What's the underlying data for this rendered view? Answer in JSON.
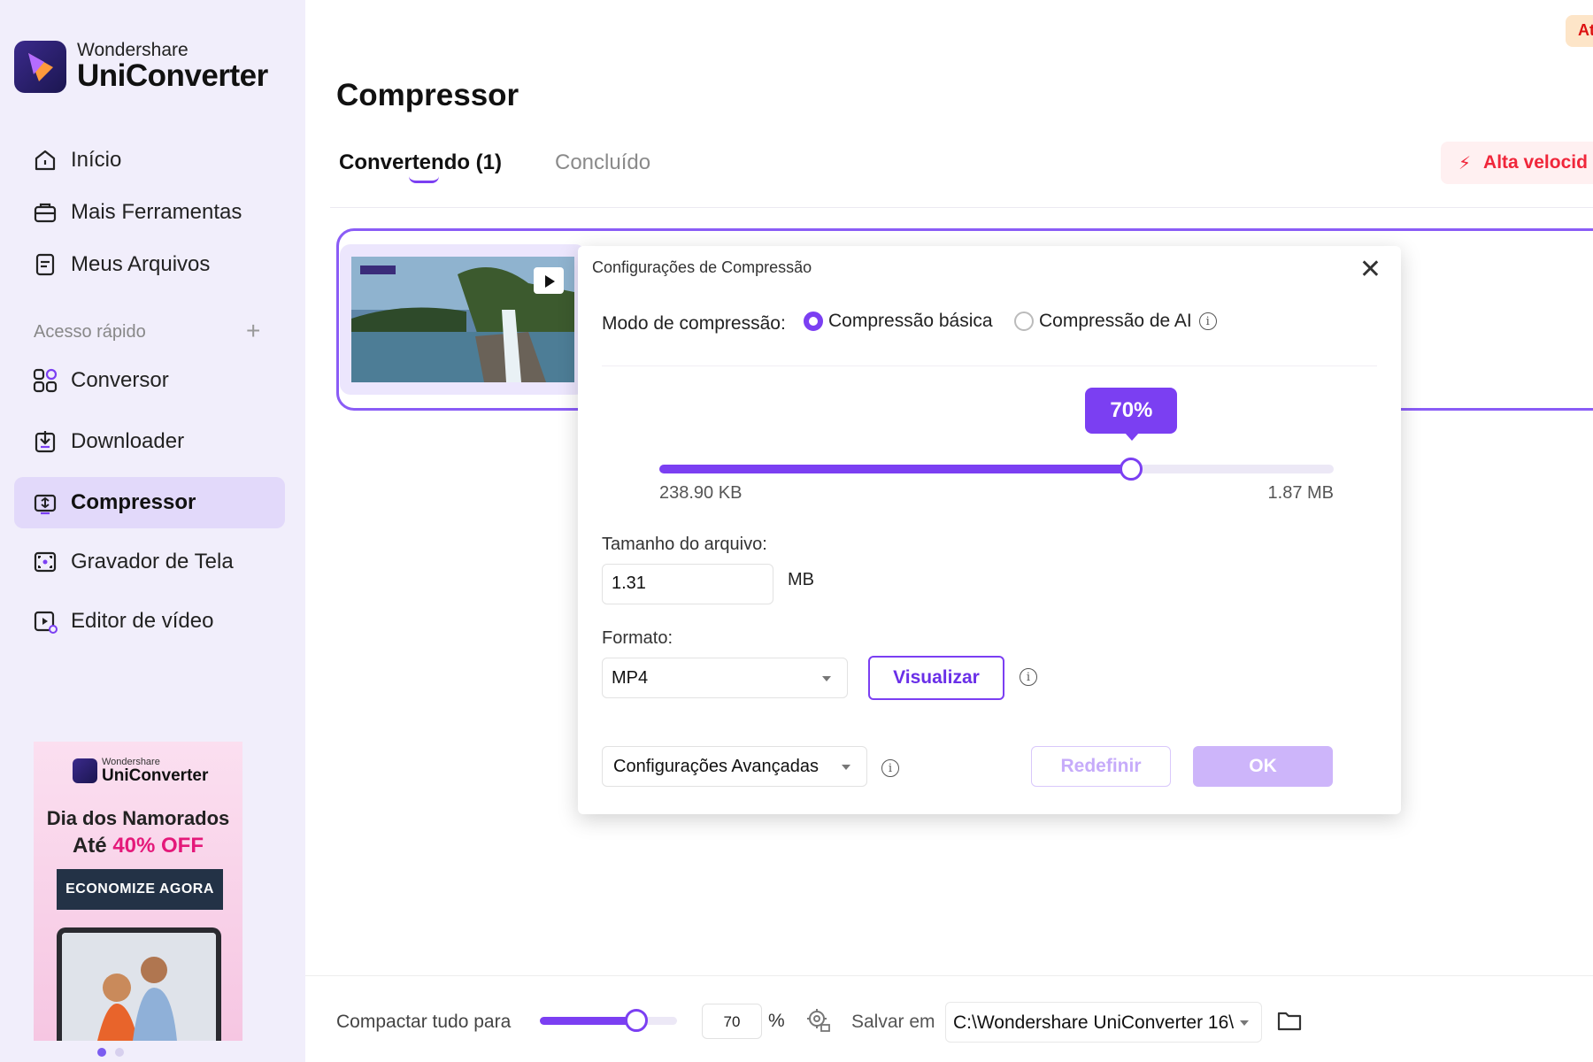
{
  "app": {
    "brand": "Wondershare",
    "product": "UniConverter"
  },
  "sidebar": {
    "items": [
      {
        "label": "Início",
        "icon": "home-icon"
      },
      {
        "label": "Mais Ferramentas",
        "icon": "toolbox-icon"
      },
      {
        "label": "Meus Arquivos",
        "icon": "file-icon"
      }
    ],
    "quick_access_label": "Acesso rápido",
    "quick_items": [
      {
        "label": "Conversor",
        "icon": "convert-icon"
      },
      {
        "label": "Downloader",
        "icon": "download-icon"
      },
      {
        "label": "Compressor",
        "icon": "compress-icon",
        "active": true
      },
      {
        "label": "Gravador de Tela",
        "icon": "screen-record-icon"
      },
      {
        "label": "Editor de vídeo",
        "icon": "video-edit-icon"
      }
    ]
  },
  "ad": {
    "brand": "Wondershare",
    "product": "UniConverter",
    "title": "Dia dos Namorados",
    "subtitle_prefix": "Até ",
    "subtitle_highlight": "40% OFF",
    "cta": "ECONOMIZE AGORA"
  },
  "header": {
    "badge": "At",
    "title": "Compressor",
    "tabs": [
      {
        "label": "Convertendo (1)",
        "active": true
      },
      {
        "label": "Concluído",
        "active": false
      }
    ],
    "speed_button": "Alta velocid"
  },
  "dialog": {
    "title": "Configurações de Compressão",
    "mode_label": "Modo de compressão:",
    "modes": [
      {
        "label": "Compressão básica",
        "selected": true
      },
      {
        "label": "Compressão de AI",
        "selected": false
      }
    ],
    "percent_label": "70%",
    "percent_value": 0.7,
    "min_size": "238.90 KB",
    "max_size": "1.87 MB",
    "file_size_label": "Tamanho do arquivo:",
    "file_size_value": "1.31",
    "file_size_unit": "MB",
    "format_label": "Formato:",
    "format_value": "MP4",
    "preview_button": "Visualizar",
    "advanced_label": "Configurações Avançadas",
    "reset_button": "Redefinir",
    "ok_button": "OK"
  },
  "bottom": {
    "compress_all_label": "Compactar tudo para",
    "compress_all_value": 0.7,
    "percent_value": "70",
    "percent_sign": "%",
    "save_label": "Salvar em",
    "save_path": "C:\\Wondershare UniConverter 16\\"
  },
  "colors": {
    "accent": "#7b3ff2",
    "sidebar_bg": "#f1eefb",
    "active_item_bg": "#e2d9fa",
    "danger": "#f0263a"
  }
}
